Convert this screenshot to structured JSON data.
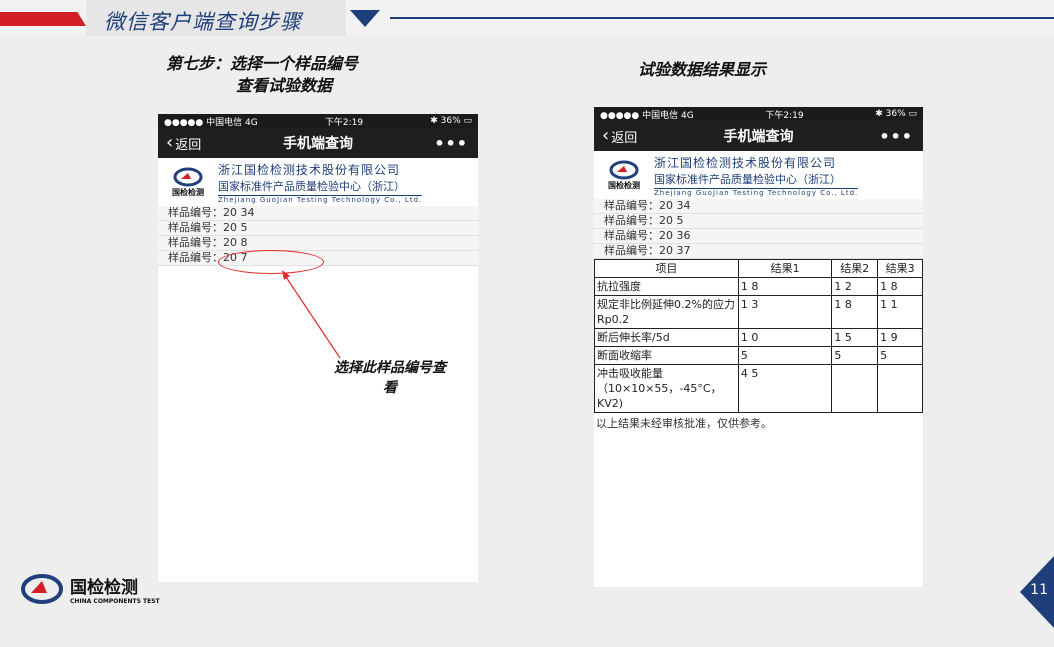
{
  "header": {
    "title": "微信客户端查询步骤"
  },
  "captions": {
    "left_line1": "第七步：选择一个样品编号",
    "left_line2": "查看试验数据",
    "right": "试验数据结果显示"
  },
  "phone": {
    "status_left": "●●●●● 中国电信  4G",
    "status_time": "下午2:19",
    "status_right": "✱ 36% ▭",
    "back_label": "返回",
    "nav_title": "手机端查询",
    "more_label": "•••",
    "logo_text": "国检检测",
    "company_line1": "浙江国检检测技术股份有限公司",
    "company_line2": "国家标准件产品质量检验中心（浙江）",
    "company_line3": "Zhejiang GuoJian Testing Technology Co., Ltd."
  },
  "left_samples": [
    "样品编号：20        34",
    "样品编号：20        5",
    "样品编号：20        8",
    "样品编号：20        7"
  ],
  "right_samples": [
    "样品编号：20        34",
    "样品编号：20        5",
    "样品编号：20        36",
    "样品编号：20        37"
  ],
  "table": {
    "headers": [
      "项目",
      "结果1",
      "结果2",
      "结果3"
    ],
    "rows": [
      [
        "抗拉强度",
        "1  8",
        "1  2",
        "1  8"
      ],
      [
        "规定非比例延伸0.2%的应力Rp0.2",
        "1  3",
        "1  8",
        "1  1"
      ],
      [
        "断后伸长率/5d",
        "1  0",
        "1  5",
        "1  9"
      ],
      [
        "断面收缩率",
        "5",
        "5",
        "5"
      ],
      [
        "冲击吸收能量（10×10×55，-45°C，KV2)",
        "4                 5",
        "",
        ""
      ]
    ],
    "note": "以上结果未经审核批准，仅供参考。"
  },
  "annotation": {
    "line1": "选择此样品编号查",
    "line2": "看"
  },
  "footer": {
    "logo_cn": "国检检测",
    "logo_en": "CHINA COMPONENTS TEST"
  },
  "page_number": "11",
  "colors": {
    "accent": "#1f3f7a",
    "red": "#d32027"
  }
}
